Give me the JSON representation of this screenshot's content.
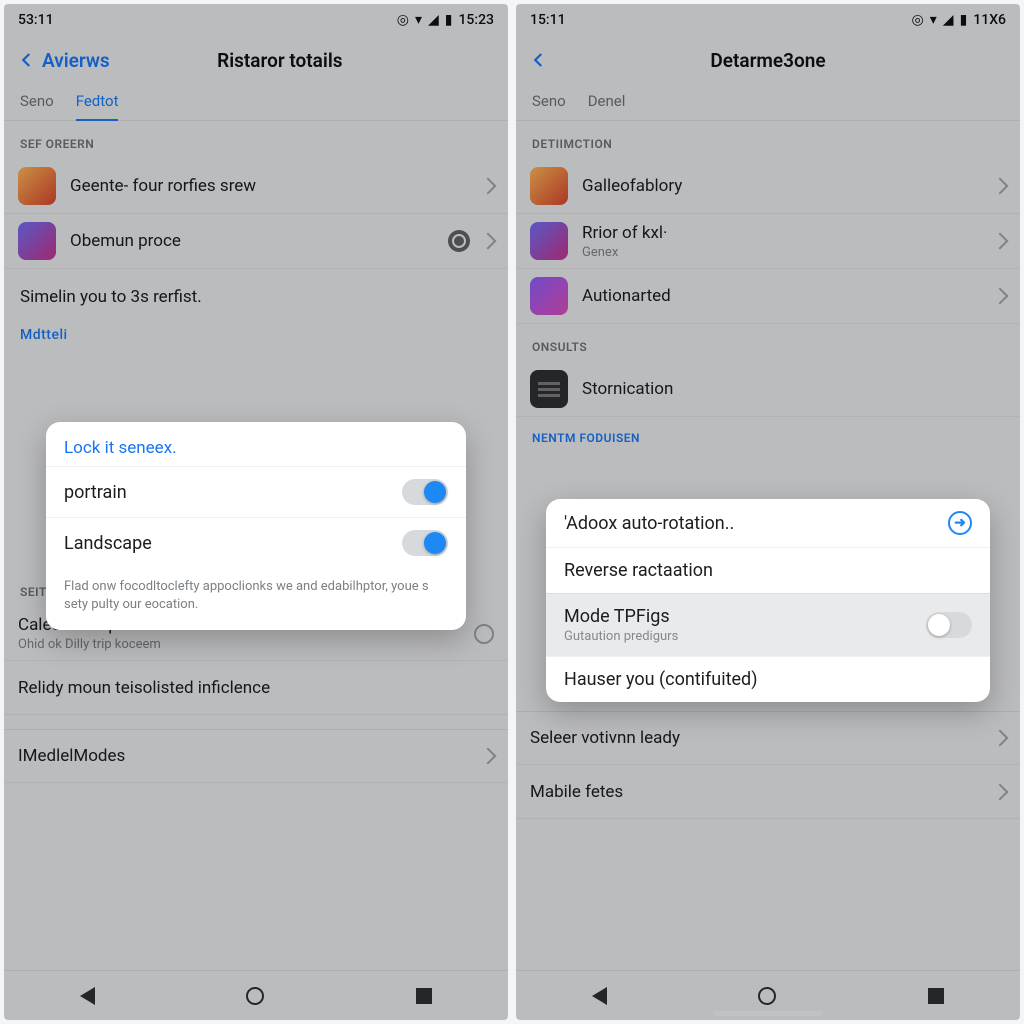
{
  "left": {
    "status": {
      "time": "53:11",
      "right": "15:23"
    },
    "header": {
      "back": "Avierws",
      "title": "Ristaror totails"
    },
    "tabs": [
      "Seno",
      "Fedtot"
    ],
    "active_tab": 1,
    "section1": "SEF OREERN",
    "items1": [
      {
        "label": "Geente- four rorfies srew"
      },
      {
        "label": "Obemun proce"
      }
    ],
    "body_text": "Simelin you to 3s rerfist.",
    "section_alt": "Mdtteli",
    "popup": {
      "title": "Lock it seneex.",
      "options": [
        {
          "label": "portrain",
          "on": true
        },
        {
          "label": "Landscape",
          "on": true
        }
      ],
      "note": "Flad onw focodltoclefty appoclionks we and edabilhptor, youe s sety pulty our eocation."
    },
    "section2": "SEITURES",
    "items2": [
      {
        "label": "Caleer nianquer aseavailable",
        "sub": "Ohid ok Dilly trip koceem"
      },
      {
        "label": "Relidy moun teisolisted inficlence"
      }
    ],
    "footer_item": "IMedlelModes"
  },
  "right": {
    "status": {
      "time": "15:11",
      "right": "11X6"
    },
    "header": {
      "title": "Detarme3one"
    },
    "tabs": [
      "Seno",
      "Denel"
    ],
    "section1": "DETIIMCTION",
    "items1": [
      {
        "label": "Galleofablory"
      },
      {
        "label": "Rrior of kxl·",
        "sub": "Genex"
      },
      {
        "label": "Autionarted"
      }
    ],
    "section2": "ONSULTS",
    "items2": [
      {
        "label": "Stornication"
      }
    ],
    "section3": "NENTM FODUISEN",
    "popup": {
      "rows": [
        {
          "label": "'Adoox auto-rotation..",
          "info": true
        },
        {
          "label": "Reverse ractaation"
        },
        {
          "label": "Mode TPFigs",
          "sub": "Gutaution predigurs",
          "toggle": true,
          "on": false,
          "muted": true
        },
        {
          "label": "Hauser you (contifuited)"
        }
      ]
    },
    "bottom_items": [
      {
        "label": "Seleer votivnn leady"
      },
      {
        "label": "Mabile fetes"
      }
    ]
  }
}
